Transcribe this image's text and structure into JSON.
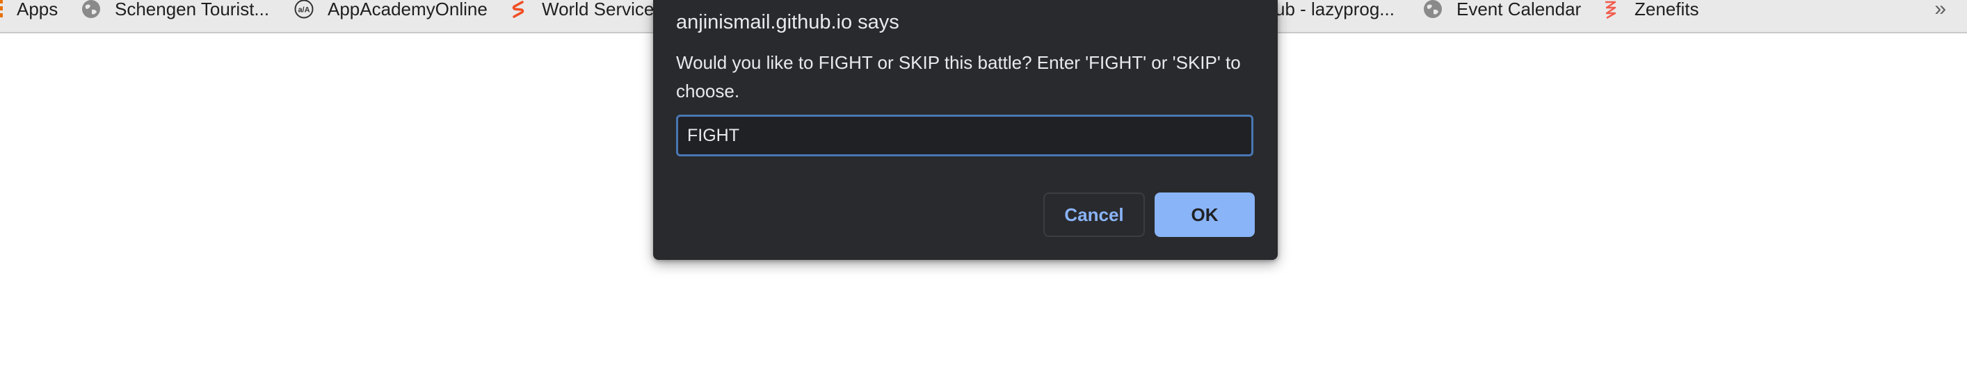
{
  "bookmarks_bar": {
    "items": [
      {
        "label": "Apps",
        "icon": "apps-grid-icon"
      },
      {
        "label": "Schengen Tourist...",
        "icon": "globe-icon"
      },
      {
        "label": "AppAcademyOnline",
        "icon": "appacademy-logo-icon"
      },
      {
        "label": "World Service",
        "icon": "s-logo-icon"
      },
      {
        "label": "ub - lazyprog...",
        "icon": "github-icon"
      },
      {
        "label": "Event Calendar",
        "icon": "globe-icon"
      },
      {
        "label": "Zenefits",
        "icon": "zenefits-logo-icon"
      }
    ],
    "overflow_label": "»"
  },
  "dialog": {
    "title": "anjinismail.github.io says",
    "message": "Would you like to FIGHT or SKIP this battle? Enter 'FIGHT' or 'SKIP' to choose.",
    "input_value": "FIGHT",
    "cancel_label": "Cancel",
    "ok_label": "OK"
  },
  "colors": {
    "dialog_background": "#292a2d",
    "accent": "#8ab4f8",
    "input_border": "#4a77b4",
    "bookmarks_bar_background": "#e9e9e9"
  }
}
